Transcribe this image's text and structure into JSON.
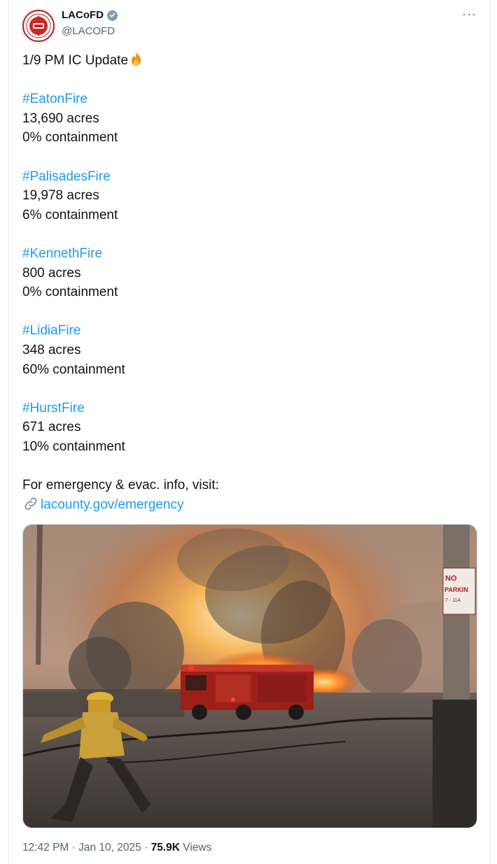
{
  "author": {
    "display_name": "LACoFD",
    "handle": "@LACOFD",
    "verified": true,
    "avatar_icon": "fire-department-seal-icon"
  },
  "menu": {
    "more_label": "···"
  },
  "tweet": {
    "title_text": "1/9 PM IC Update",
    "title_emoji": "fire-emoji",
    "fires": [
      {
        "hashtag": "#EatonFire",
        "acres": "13,690 acres",
        "containment": "0% containment"
      },
      {
        "hashtag": "#PalisadesFire",
        "acres": "19,978 acres",
        "containment": "6% containment"
      },
      {
        "hashtag": "#KennethFire",
        "acres": "800 acres",
        "containment": "0% containment"
      },
      {
        "hashtag": "#LidiaFire",
        "acres": "348 acres",
        "containment": "60% containment"
      },
      {
        "hashtag": "#HurstFire",
        "acres": "671 acres",
        "containment": "10% containment"
      }
    ],
    "footer_text": "For emergency & evac. info, visit:",
    "link_text": "lacounty.gov/emergency",
    "link_icon": "link-icon"
  },
  "media": {
    "sign_line1": "NO",
    "sign_line2": "PARKIN",
    "sign_line3": "7 - 11A"
  },
  "meta": {
    "time": "12:42 PM",
    "separator": "·",
    "date": "Jan 10, 2025",
    "views_count": "75.9K",
    "views_label": "Views"
  },
  "colors": {
    "link": "#1d9bf0",
    "text": "#0f1419",
    "secondary": "#536471",
    "verified_badge": "#829aab"
  }
}
